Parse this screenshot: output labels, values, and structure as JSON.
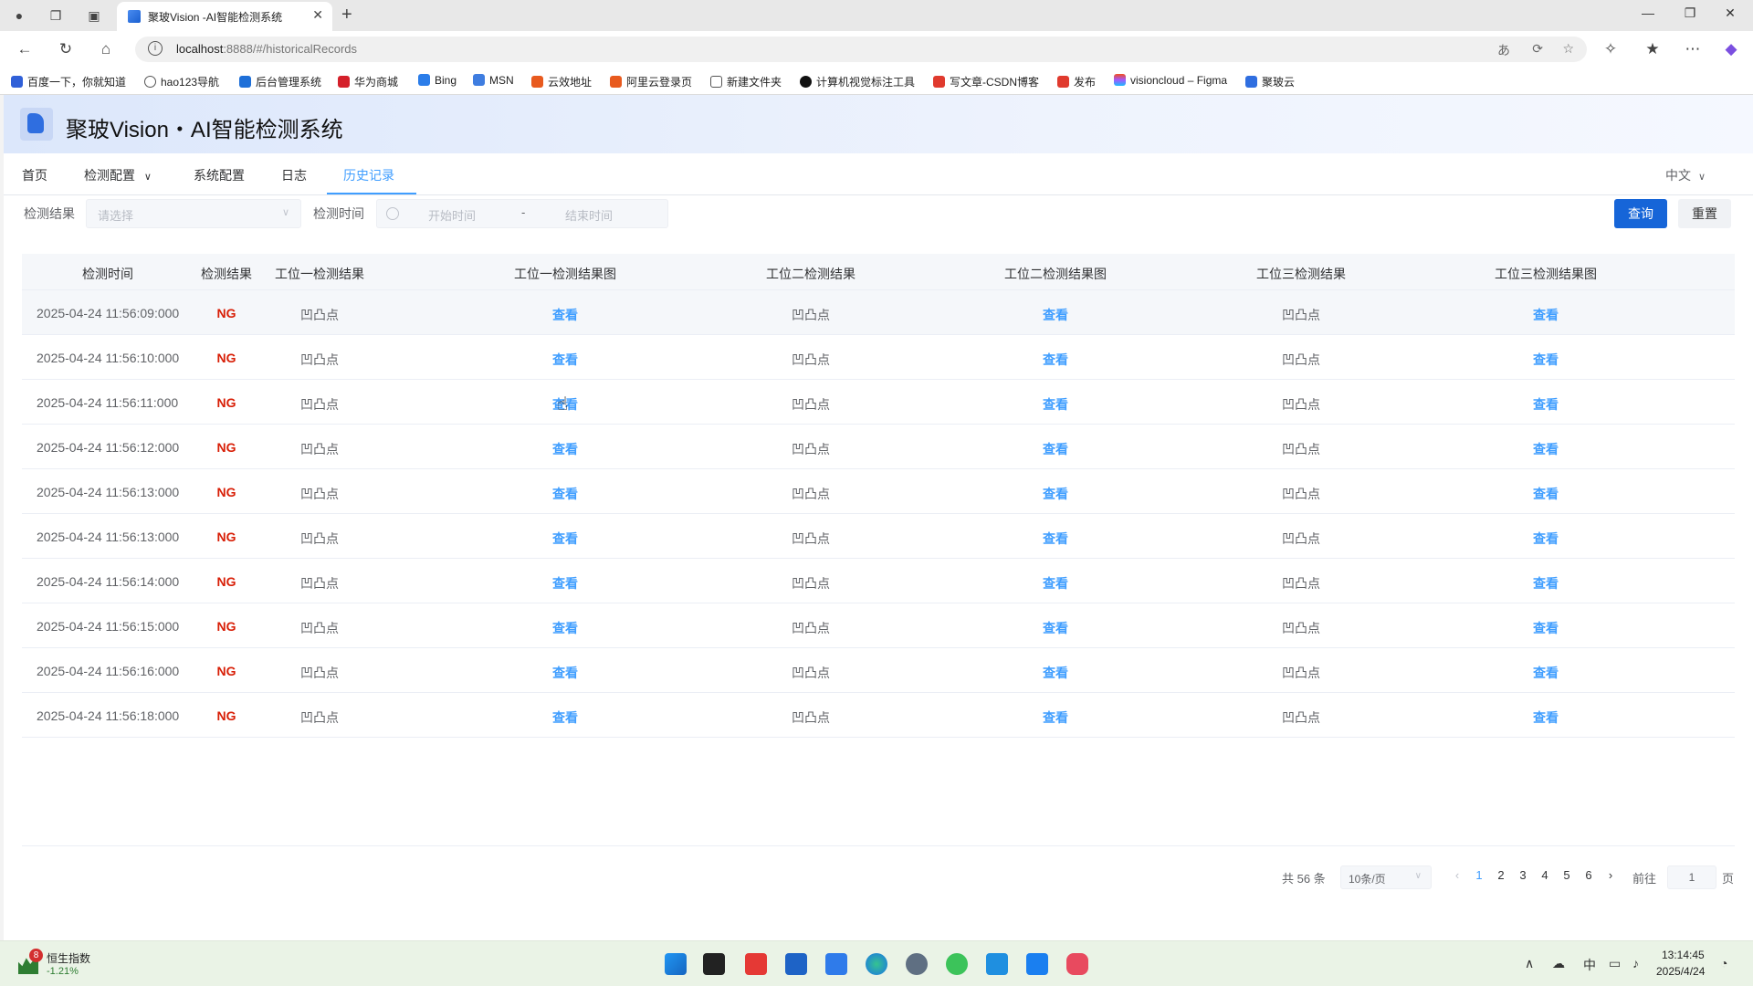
{
  "browser": {
    "tab_title": "聚玻Vision -AI智能检测系统",
    "url_host": "localhost",
    "url_rest": ":8888/#/historicalRecords",
    "bookmarks": [
      "百度一下，你就知道",
      "hao123导航",
      "后台管理系统",
      "华为商城",
      "Bing",
      "MSN",
      "云效地址",
      "阿里云登录页",
      "新建文件夹",
      "计算机视觉标注工具",
      "写文章-CSDN博客",
      "发布",
      "visioncloud – Figma",
      "聚玻云"
    ]
  },
  "app": {
    "title": "聚玻Vision・AI智能检测系统",
    "menu": [
      "首页",
      "检测配置",
      "系统配置",
      "日志",
      "历史记录"
    ],
    "active_menu": "历史记录",
    "language": "中文"
  },
  "filters": {
    "result_label": "检测结果",
    "result_placeholder": "请选择",
    "time_label": "检测时间",
    "start_placeholder": "开始时间",
    "separator": "-",
    "end_placeholder": "结束时间",
    "query_label": "查询",
    "reset_label": "重置"
  },
  "table": {
    "headers": [
      "检测时间",
      "检测结果",
      "工位一检测结果",
      "工位一检测结果图",
      "工位二检测结果",
      "工位二检测结果图",
      "工位三检测结果",
      "工位三检测结果图"
    ],
    "rows": [
      {
        "time": "2025-04-24 11:56:09:000",
        "result": "NG",
        "s1": "凹凸点",
        "s1_img": "查看",
        "s2": "凹凸点",
        "s2_img": "查看",
        "s3": "凹凸点",
        "s3_img": "查看"
      },
      {
        "time": "2025-04-24 11:56:10:000",
        "result": "NG",
        "s1": "凹凸点",
        "s1_img": "查看",
        "s2": "凹凸点",
        "s2_img": "查看",
        "s3": "凹凸点",
        "s3_img": "查看"
      },
      {
        "time": "2025-04-24 11:56:11:000",
        "result": "NG",
        "s1": "凹凸点",
        "s1_img": "查看",
        "s2": "凹凸点",
        "s2_img": "查看",
        "s3": "凹凸点",
        "s3_img": "查看"
      },
      {
        "time": "2025-04-24 11:56:12:000",
        "result": "NG",
        "s1": "凹凸点",
        "s1_img": "查看",
        "s2": "凹凸点",
        "s2_img": "查看",
        "s3": "凹凸点",
        "s3_img": "查看"
      },
      {
        "time": "2025-04-24 11:56:13:000",
        "result": "NG",
        "s1": "凹凸点",
        "s1_img": "查看",
        "s2": "凹凸点",
        "s2_img": "查看",
        "s3": "凹凸点",
        "s3_img": "查看"
      },
      {
        "time": "2025-04-24 11:56:13:000",
        "result": "NG",
        "s1": "凹凸点",
        "s1_img": "查看",
        "s2": "凹凸点",
        "s2_img": "查看",
        "s3": "凹凸点",
        "s3_img": "查看"
      },
      {
        "time": "2025-04-24 11:56:14:000",
        "result": "NG",
        "s1": "凹凸点",
        "s1_img": "查看",
        "s2": "凹凸点",
        "s2_img": "查看",
        "s3": "凹凸点",
        "s3_img": "查看"
      },
      {
        "time": "2025-04-24 11:56:15:000",
        "result": "NG",
        "s1": "凹凸点",
        "s1_img": "查看",
        "s2": "凹凸点",
        "s2_img": "查看",
        "s3": "凹凸点",
        "s3_img": "查看"
      },
      {
        "time": "2025-04-24 11:56:16:000",
        "result": "NG",
        "s1": "凹凸点",
        "s1_img": "查看",
        "s2": "凹凸点",
        "s2_img": "查看",
        "s3": "凹凸点",
        "s3_img": "查看"
      },
      {
        "time": "2025-04-24 11:56:18:000",
        "result": "NG",
        "s1": "凹凸点",
        "s1_img": "查看",
        "s2": "凹凸点",
        "s2_img": "查看",
        "s3": "凹凸点",
        "s3_img": "查看"
      }
    ]
  },
  "pagination": {
    "total_text": "共 56 条",
    "page_size": "10条/页",
    "pages": [
      "1",
      "2",
      "3",
      "4",
      "5",
      "6"
    ],
    "current_page": "1",
    "goto_label": "前往",
    "goto_value": "1",
    "page_suffix": "页"
  },
  "taskbar": {
    "widget_badge": "8",
    "widget_name": "恒生指数",
    "widget_change": "-1.21%",
    "ime": "中",
    "time": "13:14:45",
    "date": "2025/4/24"
  },
  "colors": {
    "accent": "#409eff",
    "primary_button": "#1665d8",
    "ng": "#d81e06"
  }
}
